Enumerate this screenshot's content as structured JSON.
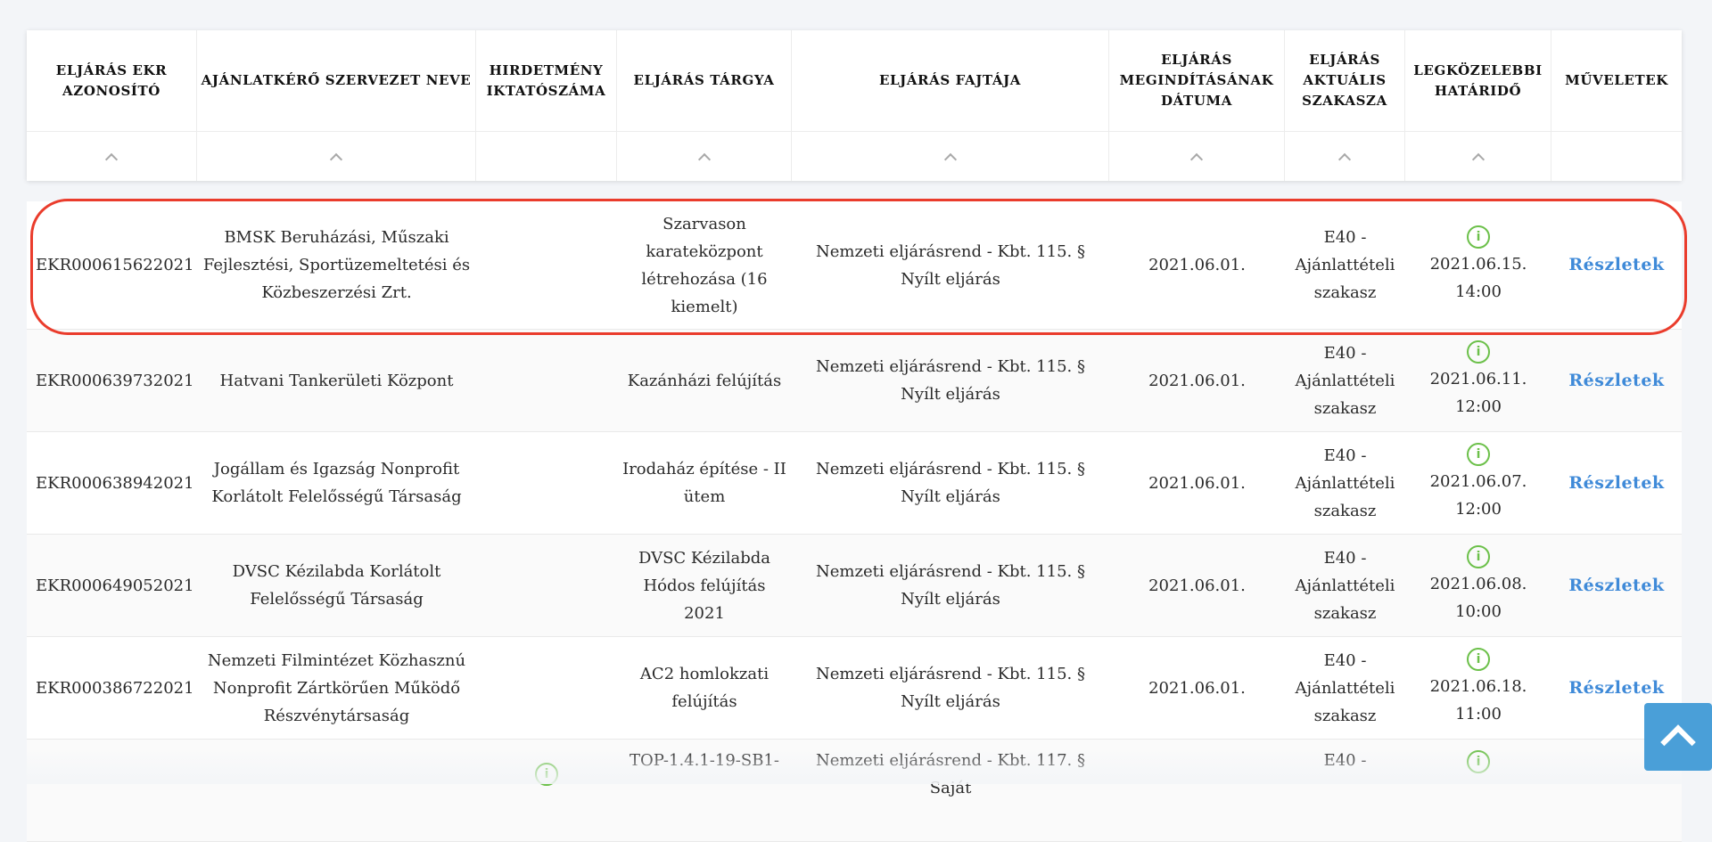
{
  "columns": [
    {
      "label": "ELJÁRÁS EKR AZONOSÍTÓ",
      "sortable": true
    },
    {
      "label": "AJÁNLATKÉRŐ SZERVEZET NEVE",
      "sortable": true
    },
    {
      "label": "HIRDETMÉNY IKTATÓSZÁMA",
      "sortable": false
    },
    {
      "label": "ELJÁRÁS TÁRGYA",
      "sortable": true
    },
    {
      "label": "ELJÁRÁS FAJTÁJA",
      "sortable": true
    },
    {
      "label": "ELJÁRÁS MEGINDÍTÁSÁNAK DÁTUMA",
      "sortable": true
    },
    {
      "label": "ELJÁRÁS AKTUÁLIS SZAKASZA",
      "sortable": true
    },
    {
      "label": "LEGKÖZELEBBI HATÁRIDŐ",
      "sortable": true
    },
    {
      "label": "MŰVELETEK",
      "sortable": false
    }
  ],
  "rows": [
    {
      "id": "EKR000615622021",
      "org": "BMSK Beruházási, Műszaki Fejlesztési, Sportüzemeltetési és Közbeszerzési Zrt.",
      "notice": "",
      "subject": "Szarvason karateközpont létrehozása (16 kiemelt)",
      "type": "Nemzeti eljárásrend - Kbt. 115. § Nyílt eljárás",
      "start": "2021.06.01.",
      "stage": "E40 - Ajánlattételi szakasz",
      "deadline": "2021.06.15. 14:00",
      "action": "Részletek",
      "highlighted": true
    },
    {
      "id": "EKR000639732021",
      "org": "Hatvani Tankerületi Központ",
      "notice": "",
      "subject": "Kazánházi felújítás",
      "type": "Nemzeti eljárásrend - Kbt. 115. § Nyílt eljárás",
      "start": "2021.06.01.",
      "stage": "E40 - Ajánlattételi szakasz",
      "deadline": "2021.06.11. 12:00",
      "action": "Részletek",
      "highlighted": false
    },
    {
      "id": "EKR000638942021",
      "org": "Jogállam és Igazság Nonprofit Korlátolt Felelősségű Társaság",
      "notice": "",
      "subject": "Irodaház építése - II ütem",
      "type": "Nemzeti eljárásrend - Kbt. 115. § Nyílt eljárás",
      "start": "2021.06.01.",
      "stage": "E40 - Ajánlattételi szakasz",
      "deadline": "2021.06.07. 12:00",
      "action": "Részletek",
      "highlighted": false
    },
    {
      "id": "EKR000649052021",
      "org": "DVSC Kézilabda Korlátolt Felelősségű Társaság",
      "notice": "",
      "subject": "DVSC Kézilabda Hódos felújítás 2021",
      "type": "Nemzeti eljárásrend - Kbt. 115. § Nyílt eljárás",
      "start": "2021.06.01.",
      "stage": "E40 - Ajánlattételi szakasz",
      "deadline": "2021.06.08. 10:00",
      "action": "Részletek",
      "highlighted": false
    },
    {
      "id": "EKR000386722021",
      "org": "Nemzeti Filmintézet Közhasznú Nonprofit Zártkörűen Működő Részvénytársaság",
      "notice": "",
      "subject": "AC2 homlokzati felújítás",
      "type": "Nemzeti eljárásrend - Kbt. 115. § Nyílt eljárás",
      "start": "2021.06.01.",
      "stage": "E40 - Ajánlattételi szakasz",
      "deadline": "2021.06.18. 11:00",
      "action": "Részletek",
      "highlighted": false
    },
    {
      "id": "",
      "org": "",
      "notice": "",
      "subject": "TOP-1.4.1-19-SB1-",
      "type": "Nemzeti eljárásrend - Kbt. 117. § Saját",
      "start": "",
      "stage": "E40 -",
      "deadline": "",
      "action": "",
      "highlighted": false
    }
  ],
  "icons": {
    "sort": "chevron-up-icon",
    "deadline": "info-circle-icon",
    "scroll_top": "chevron-up-icon"
  },
  "colors": {
    "accent": "#3f8ad8",
    "highlight": "#ea3c2c",
    "info": "#6cc04a",
    "scroll_button": "#4a9fd8"
  }
}
